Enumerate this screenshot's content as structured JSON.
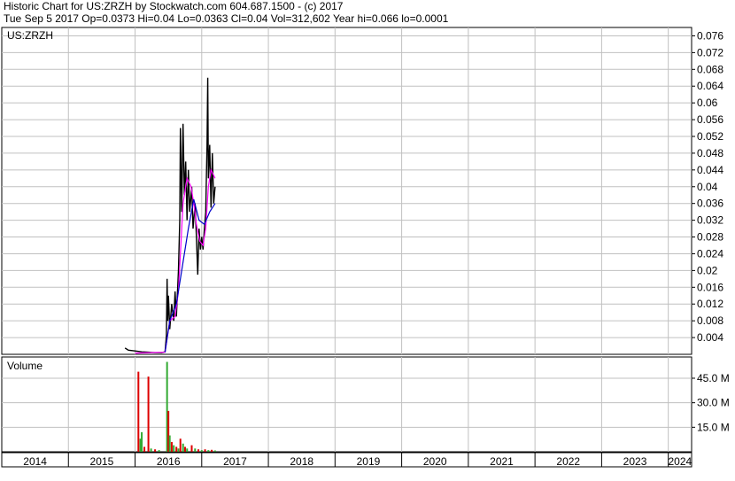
{
  "header": {
    "line1": "Historic Chart for US:ZRZH by Stockwatch.com 604.687.1500 - (c) 2017",
    "line2": "Tue Sep  5 2017  Op=0.0373  Hi=0.04  Lo=0.0363  Cl=0.04  Vol=312,602  Year hi=0.066  lo=0.0001"
  },
  "colors": {
    "grid": "#c0c0c0",
    "price": "#000000",
    "ma_short": "#ff00ff",
    "ma_long": "#0000cc",
    "vol_up": "#33aa33",
    "vol_down": "#dd0000"
  },
  "chart_data": [
    {
      "type": "line",
      "panel": "price",
      "title": "US:ZRZH",
      "y_ticks": [
        "0.004",
        "0.008",
        "0.012",
        "0.016",
        "0.02",
        "0.024",
        "0.028",
        "0.032",
        "0.036",
        "0.04",
        "0.044",
        "0.048",
        "0.052",
        "0.056",
        "0.06",
        "0.064",
        "0.068",
        "0.072",
        "0.076"
      ],
      "ylim": [
        0,
        0.078
      ],
      "xlim": [
        2014.0,
        2024.35
      ],
      "series": [
        {
          "role": "price",
          "points": [
            [
              2015.85,
              0.0015
            ],
            [
              2015.9,
              0.001
            ],
            [
              2016.0,
              0.0008
            ],
            [
              2016.1,
              0.0006
            ],
            [
              2016.2,
              0.0005
            ],
            [
              2016.3,
              0.0004
            ],
            [
              2016.4,
              0.0004
            ],
            [
              2016.45,
              0.0006
            ],
            [
              2016.47,
              0.0045
            ],
            [
              2016.48,
              0.018
            ],
            [
              2016.49,
              0.008
            ],
            [
              2016.5,
              0.014
            ],
            [
              2016.52,
              0.006
            ],
            [
              2016.55,
              0.012
            ],
            [
              2016.58,
              0.008
            ],
            [
              2016.6,
              0.015
            ],
            [
              2016.62,
              0.009
            ],
            [
              2016.65,
              0.02
            ],
            [
              2016.67,
              0.032
            ],
            [
              2016.68,
              0.054
            ],
            [
              2016.7,
              0.034
            ],
            [
              2016.72,
              0.055
            ],
            [
              2016.74,
              0.038
            ],
            [
              2016.76,
              0.046
            ],
            [
              2016.78,
              0.032
            ],
            [
              2016.8,
              0.044
            ],
            [
              2016.82,
              0.034
            ],
            [
              2016.85,
              0.04
            ],
            [
              2016.87,
              0.03
            ],
            [
              2016.9,
              0.036
            ],
            [
              2016.92,
              0.028
            ],
            [
              2016.94,
              0.019
            ],
            [
              2016.96,
              0.03
            ],
            [
              2016.98,
              0.025
            ],
            [
              2017.0,
              0.028
            ],
            [
              2017.02,
              0.025
            ],
            [
              2017.04,
              0.03
            ],
            [
              2017.06,
              0.034
            ],
            [
              2017.08,
              0.05
            ],
            [
              2017.09,
              0.066
            ],
            [
              2017.1,
              0.042
            ],
            [
              2017.12,
              0.05
            ],
            [
              2017.14,
              0.035
            ],
            [
              2017.16,
              0.048
            ],
            [
              2017.18,
              0.036
            ],
            [
              2017.2,
              0.04
            ]
          ]
        },
        {
          "role": "ma-short",
          "points": [
            [
              2016.0,
              0.0003
            ],
            [
              2016.45,
              0.0005
            ],
            [
              2016.52,
              0.008
            ],
            [
              2016.6,
              0.009
            ],
            [
              2016.65,
              0.015
            ],
            [
              2016.72,
              0.036
            ],
            [
              2016.78,
              0.042
            ],
            [
              2016.84,
              0.04
            ],
            [
              2016.88,
              0.036
            ],
            [
              2016.92,
              0.031
            ],
            [
              2016.97,
              0.027
            ],
            [
              2017.02,
              0.026
            ],
            [
              2017.06,
              0.03
            ],
            [
              2017.1,
              0.04
            ],
            [
              2017.14,
              0.044
            ],
            [
              2017.2,
              0.042
            ]
          ]
        },
        {
          "role": "ma-long",
          "points": [
            [
              2016.45,
              0.0005
            ],
            [
              2016.52,
              0.008
            ],
            [
              2016.62,
              0.012
            ],
            [
              2016.7,
              0.02
            ],
            [
              2016.8,
              0.03
            ],
            [
              2016.88,
              0.037
            ],
            [
              2016.96,
              0.032
            ],
            [
              2017.04,
              0.031
            ],
            [
              2017.12,
              0.034
            ],
            [
              2017.2,
              0.036
            ]
          ]
        }
      ]
    },
    {
      "type": "bar",
      "panel": "volume",
      "title": "Volume",
      "y_ticks": [
        "15.0 M",
        "30.0 M",
        "45.0 M"
      ],
      "ylim": [
        0,
        58
      ],
      "bars": [
        {
          "x": 2016.05,
          "v": 49,
          "up": false
        },
        {
          "x": 2016.08,
          "v": 8,
          "up": true
        },
        {
          "x": 2016.1,
          "v": 12,
          "up": true
        },
        {
          "x": 2016.14,
          "v": 3,
          "up": false
        },
        {
          "x": 2016.2,
          "v": 46,
          "up": false
        },
        {
          "x": 2016.24,
          "v": 2,
          "up": true
        },
        {
          "x": 2016.3,
          "v": 1.5,
          "up": false
        },
        {
          "x": 2016.36,
          "v": 1,
          "up": true
        },
        {
          "x": 2016.48,
          "v": 55,
          "up": true
        },
        {
          "x": 2016.5,
          "v": 25,
          "up": false
        },
        {
          "x": 2016.52,
          "v": 10,
          "up": true
        },
        {
          "x": 2016.55,
          "v": 6,
          "up": false
        },
        {
          "x": 2016.58,
          "v": 4,
          "up": true
        },
        {
          "x": 2016.62,
          "v": 3,
          "up": false
        },
        {
          "x": 2016.65,
          "v": 2,
          "up": true
        },
        {
          "x": 2016.68,
          "v": 8,
          "up": false
        },
        {
          "x": 2016.72,
          "v": 5,
          "up": true
        },
        {
          "x": 2016.75,
          "v": 3,
          "up": false
        },
        {
          "x": 2016.78,
          "v": 2,
          "up": true
        },
        {
          "x": 2016.85,
          "v": 4,
          "up": false
        },
        {
          "x": 2016.9,
          "v": 2,
          "up": true
        },
        {
          "x": 2016.95,
          "v": 1.5,
          "up": false
        },
        {
          "x": 2017.0,
          "v": 1,
          "up": true
        },
        {
          "x": 2017.05,
          "v": 1.5,
          "up": false
        },
        {
          "x": 2017.1,
          "v": 1,
          "up": true
        },
        {
          "x": 2017.15,
          "v": 1.2,
          "up": false
        },
        {
          "x": 2017.2,
          "v": 0.8,
          "up": true
        }
      ]
    },
    {
      "type": "axis",
      "panel": "years",
      "x_ticks": [
        "2014",
        "2015",
        "2016",
        "2017",
        "2018",
        "2019",
        "2020",
        "2021",
        "2022",
        "2023",
        "2024"
      ]
    }
  ]
}
